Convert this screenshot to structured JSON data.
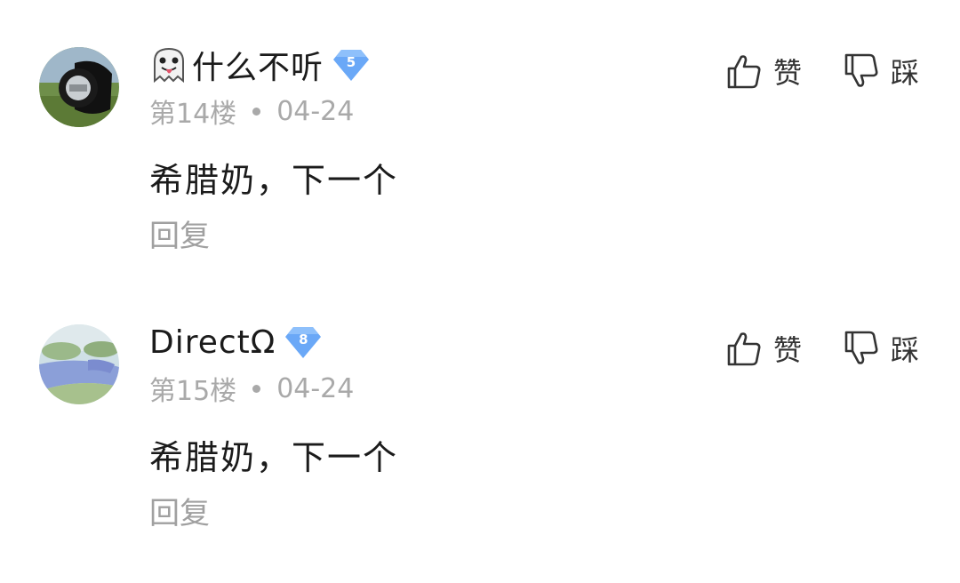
{
  "comments": [
    {
      "username": "什么不听",
      "level": "5",
      "floor": "第14楼",
      "date": "04-24",
      "text": "希腊奶，下一个",
      "reply_label": "回复",
      "like_label": "赞",
      "dislike_label": "踩",
      "name_prefix_icon": "ghost-emoji-icon"
    },
    {
      "username": "DirectΩ",
      "level": "8",
      "floor": "第15楼",
      "date": "04-24",
      "text": "希腊奶，下一个",
      "reply_label": "回复",
      "like_label": "赞",
      "dislike_label": "踩"
    }
  ],
  "colors": {
    "badge": "#6aa8f7",
    "meta_text": "#a9a9a9",
    "body_text": "#1b1b1b"
  }
}
